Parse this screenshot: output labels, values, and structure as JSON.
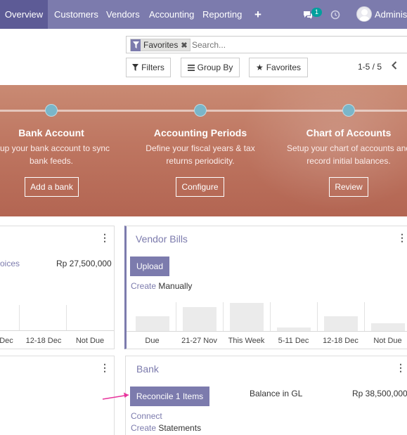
{
  "navbar": {
    "items": [
      {
        "label": "Overview",
        "active": true
      },
      {
        "label": "Customers"
      },
      {
        "label": "Vendors"
      },
      {
        "label": "Accounting"
      },
      {
        "label": "Reporting"
      }
    ],
    "plus_icon": "plus-icon",
    "chat_icon": "chat-icon",
    "chat_badge": "1",
    "clock_icon": "clock-icon",
    "user_name": "Administ"
  },
  "search": {
    "facet_label": "Favorites",
    "facet_icon": "filter-icon",
    "placeholder": "Search..."
  },
  "controls": {
    "filters": "Filters",
    "group_by": "Group By",
    "favorites": "Favorites",
    "pager": "1-5 / 5"
  },
  "banner": {
    "steps": [
      {
        "title": "Bank Account",
        "desc_line1": "etup your bank account to sync",
        "desc_line2": "bank feeds.",
        "button": "Add a bank"
      },
      {
        "title": "Accounting Periods",
        "desc_line1": "Define your fiscal years & tax",
        "desc_line2": "returns periodicity.",
        "button": "Configure"
      },
      {
        "title": "Chart of Accounts",
        "desc_line1": "Setup your chart of accounts and",
        "desc_line2": "record initial balances.",
        "button": "Review"
      }
    ]
  },
  "customer_card": {
    "invoices_link": "oices",
    "amount": "Rp 27,500,000",
    "graph_labels": [
      "Dec",
      "12-18 Dec",
      "Not Due"
    ]
  },
  "vendor_card": {
    "title": "Vendor Bills",
    "upload": "Upload",
    "create_link": "Create",
    "create_suffix": " Manually",
    "graph_labels": [
      "Due",
      "21-27 Nov",
      "This Week",
      "5-11 Dec",
      "12-18 Dec",
      "Not Due"
    ],
    "graph_values": [
      0.5,
      0.8,
      0.95,
      0.12,
      0.5,
      0.25
    ]
  },
  "bank_card": {
    "title": "Bank",
    "reconcile": "Reconcile 1 Items",
    "balance_label": "Balance in GL",
    "balance_value": "Rp 38,500,000",
    "connect_link": "Connect",
    "create_link": "Create",
    "create_suffix": " Statements"
  },
  "colors": {
    "brand": "#7c7bad",
    "brand_dark": "#5d5b96",
    "banner": "#be7661",
    "step_dot": "#7ab6c9",
    "annotation_arrow": "#e8339c"
  }
}
